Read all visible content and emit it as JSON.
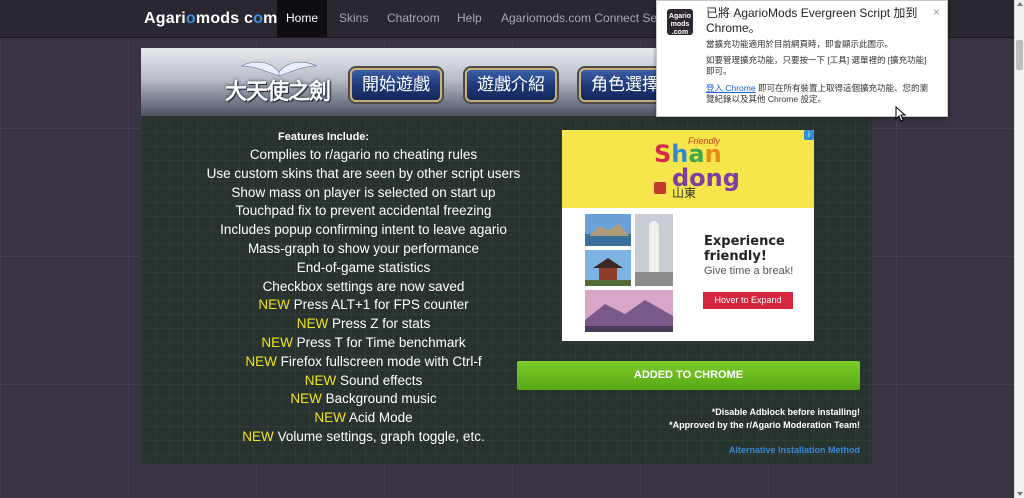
{
  "navbar": {
    "brand_part1": "Agari",
    "brand_accent": "o",
    "brand_part2": "mods c",
    "brand_accent2": "o",
    "brand_part3": "m",
    "items": [
      {
        "label": "Home",
        "active": true
      },
      {
        "label": "Skins"
      },
      {
        "label": "Chatroom"
      },
      {
        "label": "Help"
      },
      {
        "label": "Agariomods.com Connect Servic"
      }
    ]
  },
  "banner": {
    "game_title": "大天使之劍",
    "buttons": [
      "開始遊戲",
      "遊戲介紹",
      "角色選擇"
    ]
  },
  "features": {
    "title": "Features Include:",
    "new_tag": "NEW",
    "items": [
      {
        "text": "Complies to r/agario no cheating rules",
        "new": false
      },
      {
        "text": "Use custom skins that are seen by other script users",
        "new": false
      },
      {
        "text": "Show mass on player is selected on start up",
        "new": false
      },
      {
        "text": "Touchpad fix to prevent accidental freezing",
        "new": false
      },
      {
        "text": "Includes popup confirming intent to leave agario",
        "new": false
      },
      {
        "text": "Mass-graph to show your performance",
        "new": false
      },
      {
        "text": "End-of-game statistics",
        "new": false
      },
      {
        "text": "Checkbox settings are now saved",
        "new": false
      },
      {
        "text": "Press ALT+1 for FPS counter",
        "new": true
      },
      {
        "text": "Press Z for stats",
        "new": true
      },
      {
        "text": "Press T for Time benchmark",
        "new": true
      },
      {
        "text": "Firefox fullscreen mode with Ctrl-f",
        "new": true
      },
      {
        "text": "Sound effects",
        "new": true
      },
      {
        "text": "Background music",
        "new": true
      },
      {
        "text": "Acid Mode",
        "new": true
      },
      {
        "text": "Volume settings, graph toggle, etc.",
        "new": true
      }
    ]
  },
  "ad": {
    "friendly": "Friendly",
    "shan": [
      "S",
      "h",
      "a",
      "n"
    ],
    "dong": "dong",
    "chinese": "山東",
    "headline_1": "Experience",
    "headline_2": "friendly!",
    "sub": "Give time a break!",
    "button": "Hover to Expand",
    "info": "i"
  },
  "install": {
    "button": "ADDED TO CHROME",
    "note_1": "*Disable Adblock before installing!",
    "note_2": "*Approved by the r/Agario Moderation Team!",
    "alt_link": "Alternative Installation Method"
  },
  "notification": {
    "icon_text": "Agario mods .com",
    "title": "已將 AgarioMods Evergreen Script 加到 Chrome。",
    "line_1": "當擴充功能適用於目前網頁時，即會顯示此圖示。",
    "line_2": "如要管理擴充功能，只要按一下 [工具] 選單裡的 [擴充功能] 即可。",
    "link": "登入 Chrome",
    "line_3": "即可在所有裝置上取得這個擴充功能、您的瀏覽紀錄以及其他 Chrome 設定。",
    "close": "×"
  },
  "colors": {
    "accent_blue": "#3d8fe0",
    "new_yellow": "#f2e41b",
    "install_green": "#57a815",
    "ad_red": "#d5263f"
  }
}
